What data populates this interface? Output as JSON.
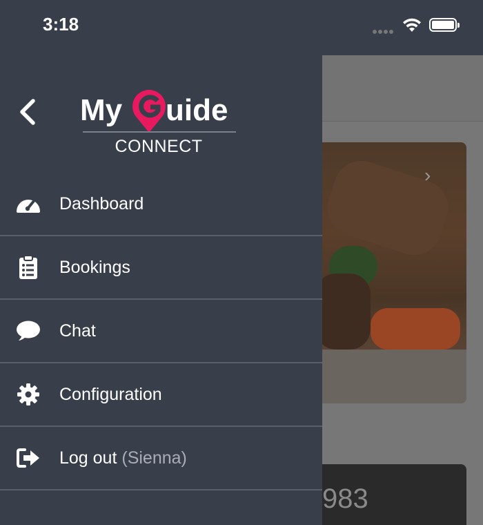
{
  "status_bar": {
    "time": "3:18"
  },
  "drawer": {
    "logo": {
      "my": "My",
      "letter_g": "G",
      "uide": "uide",
      "connect": "CONNECT",
      "accent_color": "#e8195f"
    },
    "menu": [
      {
        "label": "Dashboard",
        "icon": "dashboard-gauge-icon"
      },
      {
        "label": "Bookings",
        "icon": "clipboard-list-icon"
      },
      {
        "label": "Chat",
        "icon": "chat-bubble-icon"
      },
      {
        "label": "Configuration",
        "icon": "gear-icon"
      },
      {
        "label": "Log out",
        "sub": "(Sienna)",
        "icon": "logout-icon"
      }
    ]
  },
  "background": {
    "counter_partial": "983"
  },
  "colors": {
    "drawer_bg": "#383e4a",
    "divider": "#5a606c",
    "text": "#ffffff",
    "subtext": "#a8adb8"
  }
}
